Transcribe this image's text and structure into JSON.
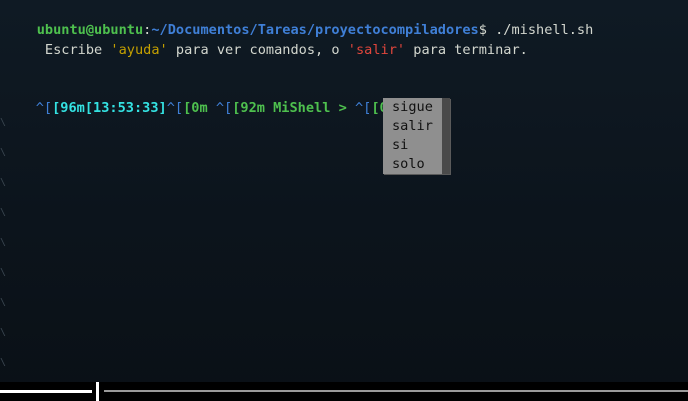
{
  "shell": {
    "user_host": "ubuntu@ubuntu",
    "colon": ":",
    "path": "~/Documentos/Tareas/proyectocompiladores",
    "dollar": "$",
    "command": " ./mishell.sh"
  },
  "welcome": {
    "prefix": " Escribe ",
    "kw_help": "'ayuda'",
    "middle": " para ver comandos, o ",
    "kw_exit": "'salir'",
    "suffix": " para terminar."
  },
  "prompt_line": {
    "esc1": "^[",
    "time_code": "[96m[13:53:33]",
    "esc2": "^[",
    "reset1": "[0m ",
    "esc3": "^[",
    "name_code": "[92m MiShell > ",
    "esc4": "^[",
    "reset2_typed": "[0ms"
  },
  "autocomplete": {
    "options": [
      "sigue",
      "salir",
      "si",
      "solo"
    ]
  },
  "colors": {
    "background": "#0f1a24",
    "user": "#4ec04e",
    "path": "#3f7fd6",
    "keyword_help": "#c4a000",
    "keyword_exit": "#e0463c",
    "time": "#34e2e2",
    "popup": "#8f8f8f"
  }
}
